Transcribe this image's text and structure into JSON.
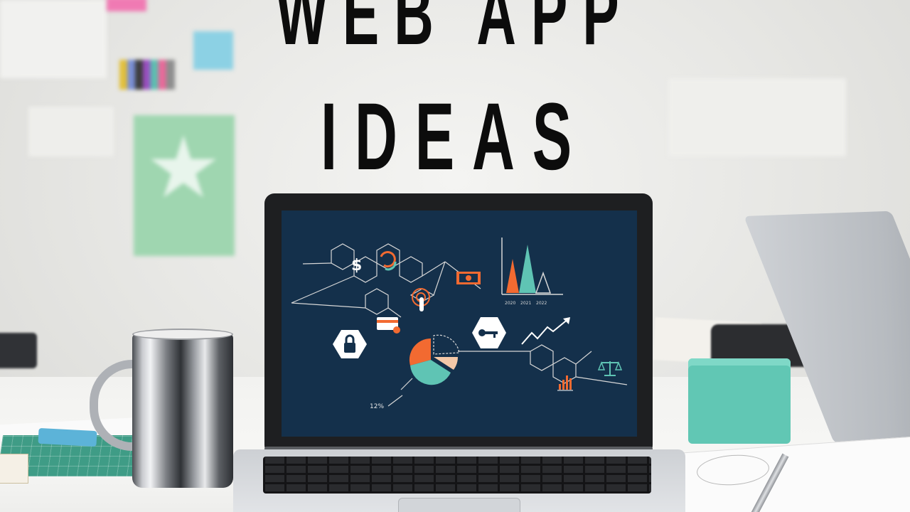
{
  "headline": {
    "line1": "WEB APP",
    "line2": "IDEAS"
  },
  "screen": {
    "percent_label": "12%",
    "dollar_symbol": "$"
  },
  "colors": {
    "screen_background": "#14304b",
    "accent_orange": "#f26a31",
    "accent_teal": "#5fc4b4",
    "accent_peach": "#f3c8a8",
    "line_color": "#d7d7d7",
    "desk_box_teal": "#61c7b4",
    "star_card_green": "#9fd6b0"
  },
  "icons": [
    "dollar-icon",
    "refresh-icon",
    "touch-icon",
    "banknote-icon",
    "credit-card-icon",
    "lock-icon",
    "key-icon",
    "pie-chart-icon",
    "triangle-chart-icon",
    "trend-arrow-icon",
    "scales-icon",
    "bar-chart-icon"
  ]
}
